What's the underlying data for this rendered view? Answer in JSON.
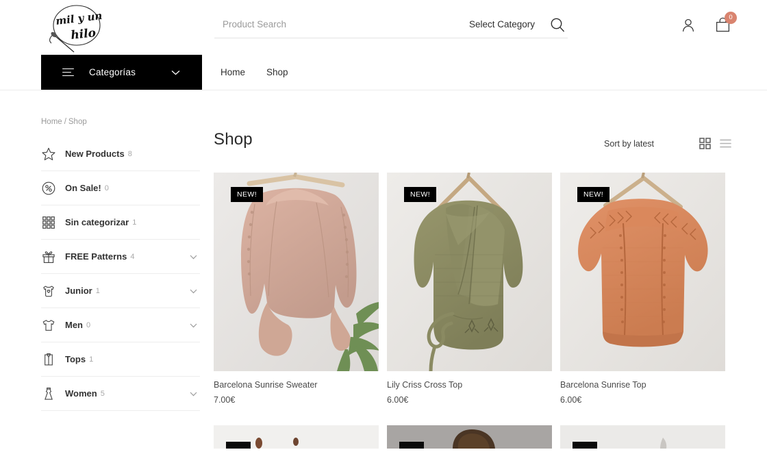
{
  "header": {
    "logo": {
      "name": "mil-y-un-hilo-logo",
      "line1": "mil y un",
      "line2": "hilo"
    },
    "search": {
      "placeholder": "Product Search",
      "value": "",
      "category_label": "Select Category",
      "icon": "search-icon"
    },
    "actions": {
      "account_icon": "user-account-icon",
      "cart_icon": "shopping-bag-icon",
      "cart_count": "0",
      "badge_color": "#d9846f"
    }
  },
  "nav": {
    "categories_button": {
      "label": "Categorías",
      "icon": "hamburger-icon",
      "chevron": "chevron-down-icon"
    },
    "links": [
      {
        "label": "Home"
      },
      {
        "label": "Shop"
      }
    ]
  },
  "sidebar": {
    "breadcrumb": {
      "home": "Home",
      "separator": "/",
      "current": "Shop"
    },
    "categories": [
      {
        "label": "New Products",
        "count": "8",
        "icon": "star-icon",
        "expandable": false
      },
      {
        "label": "On Sale!",
        "count": "0",
        "icon": "percent-circle-icon",
        "expandable": false
      },
      {
        "label": "Sin categorizar",
        "count": "1",
        "icon": "grid-squares-icon",
        "expandable": false
      },
      {
        "label": "FREE Patterns",
        "count": "4",
        "icon": "gift-box-icon",
        "expandable": true
      },
      {
        "label": "Junior",
        "count": "1",
        "icon": "onesie-icon",
        "expandable": true
      },
      {
        "label": "Men",
        "count": "0",
        "icon": "tshirt-icon",
        "expandable": true
      },
      {
        "label": "Tops",
        "count": "1",
        "icon": "shirt-icon",
        "expandable": false
      },
      {
        "label": "Women",
        "count": "5",
        "icon": "dress-icon",
        "expandable": true
      }
    ]
  },
  "main": {
    "title": "Shop",
    "sort_selected": "Sort by latest",
    "view_grid_icon": "grid-view-icon",
    "view_list_icon": "list-view-icon",
    "badge_text": "NEW!",
    "products": [
      {
        "title": "Barcelona Sunrise Sweater",
        "price": "7.00€",
        "badge": "NEW!",
        "image": "dusty-pink-knit-sweater-on-hanger-with-plant",
        "garment_color": "#d3a898",
        "wall_color": "#e6e4e2"
      },
      {
        "title": "Lily Criss Cross Top",
        "price": "6.00€",
        "badge": "NEW!",
        "image": "olive-green-criss-cross-wrap-top-on-hanger",
        "garment_color": "#8e8e66",
        "wall_color": "#e9e7e4"
      },
      {
        "title": "Barcelona Sunrise Top",
        "price": "6.00€",
        "badge": "NEW!",
        "image": "terracotta-orange-knit-top-on-hanger",
        "garment_color": "#d98458",
        "wall_color": "#eae7e4"
      }
    ],
    "products_row2": [
      {
        "image": "white-textile-closeup",
        "wall_color": "#efeeec"
      },
      {
        "image": "curly-hair-person-gray-background",
        "wall_color": "#a8a5a3"
      },
      {
        "image": "light-gray-product-photo",
        "wall_color": "#ebeae8"
      }
    ]
  }
}
